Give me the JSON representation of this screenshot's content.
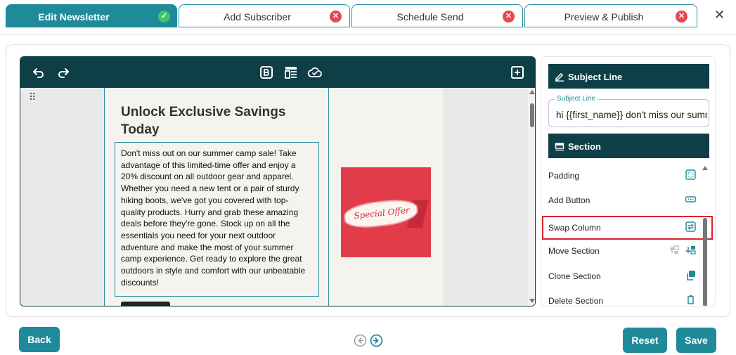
{
  "tabs": [
    {
      "label": "Edit Newsletter",
      "status": "complete",
      "status_glyph": "✓"
    },
    {
      "label": "Add Subscriber",
      "status": "incomplete",
      "status_glyph": "✕"
    },
    {
      "label": "Schedule Send",
      "status": "incomplete",
      "status_glyph": "✕"
    },
    {
      "label": "Preview & Publish",
      "status": "incomplete",
      "status_glyph": "✕"
    }
  ],
  "close_glyph": "✕",
  "editor": {
    "drag_handle_glyph": "⠿",
    "headline": "Unlock Exclusive Savings Today",
    "body": "Don't miss out on our summer camp sale! Take advantage of this limited-time offer and enjoy a 20% discount on all outdoor gear and apparel. Whether you need a new tent or a pair of sturdy hiking boots, we've got you covered with top-quality products. Hurry and grab these amazing deals before they're gone. Stock up on all the essentials you need for your next outdoor adventure and make the most of your summer camp experience. Get ready to explore the great outdoors in style and comfort with our unbeatable discounts!",
    "image_text": "Special Offer"
  },
  "panel": {
    "subject_header": "Subject Line",
    "subject_legend": "Subject Line",
    "subject_value": "hi {{first_name}} don't miss our summer sale",
    "section_header": "Section",
    "options": [
      {
        "label": "Padding",
        "icon": "padding-icon"
      },
      {
        "label": "Add Button",
        "icon": "button-icon"
      },
      {
        "label": "Swap Column",
        "icon": "swap-icon",
        "highlighted": true
      },
      {
        "label": "Move Section",
        "icon": "move-icon"
      },
      {
        "label": "Clone Section",
        "icon": "clone-icon"
      },
      {
        "label": "Delete Section",
        "icon": "trash-icon"
      }
    ]
  },
  "footer": {
    "back_label": "Back",
    "reset_label": "Reset",
    "save_label": "Save"
  },
  "colors": {
    "primary": "#1f8a9a",
    "toolbar": "#0e3f47",
    "success": "#3ec46d",
    "error": "#e8474d",
    "highlight": "#d9232b",
    "offer_bg": "#e23b4a"
  }
}
